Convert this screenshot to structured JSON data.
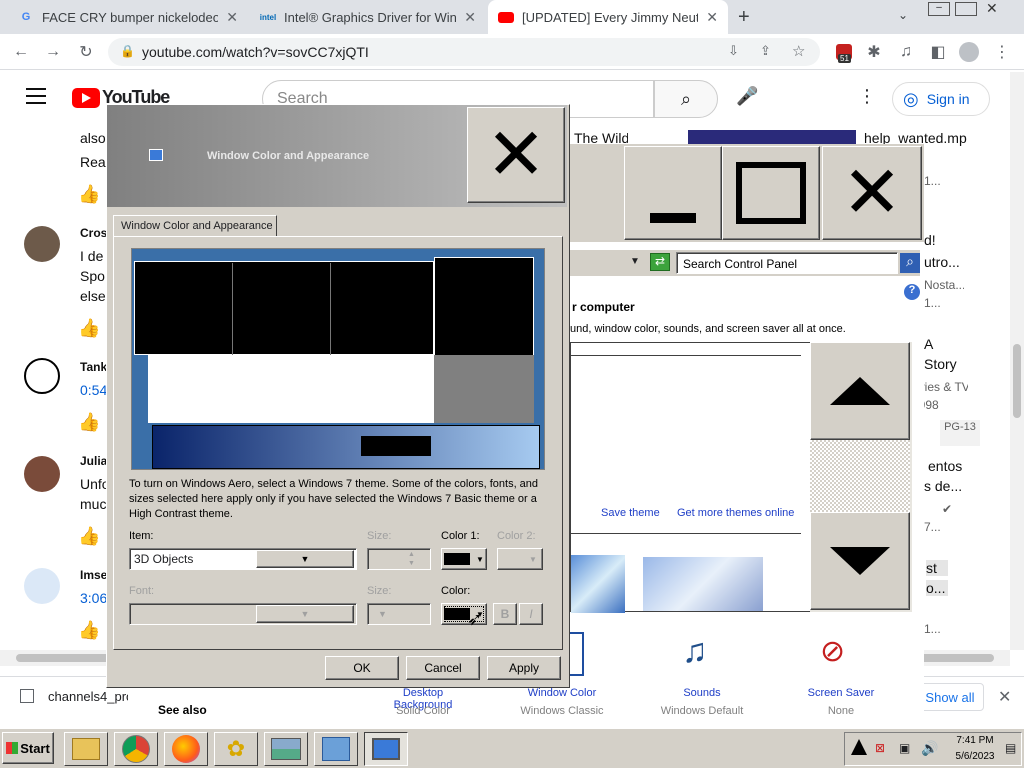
{
  "browser": {
    "tabs": [
      {
        "title": "FACE CRY bumper nickelodeon -",
        "icon": "google-favicon"
      },
      {
        "title": "Intel® Graphics Driver for Windo",
        "icon": "intel-favicon"
      },
      {
        "title": "[UPDATED] Every Jimmy Neutron",
        "icon": "youtube-favicon"
      }
    ],
    "url": "youtube.com/watch?v=sovCC7xjQTI",
    "extension_badge": "51"
  },
  "youtube": {
    "logo_text": "YouTube",
    "search_placeholder": "Search",
    "sign_in": "Sign in",
    "comments": [
      {
        "name": "",
        "line1": "also",
        "line2": "Rea"
      },
      {
        "name": "Cros",
        "line1": "I de",
        "line2": "Spo",
        "line3": "else"
      },
      {
        "name": "Tank",
        "line1": "0:54"
      },
      {
        "name": "Julia",
        "line1": "Unfo",
        "line2": "muc"
      },
      {
        "name": "Imse",
        "line1": "3:06"
      }
    ],
    "related": [
      {
        "title": "help_wanted.mp",
        "meta": "1..."
      },
      {
        "title": "d!",
        "title2": "utro...",
        "meta": "Nosta...",
        "meta2": "1..."
      },
      {
        "title": "A",
        "title2": "Story",
        "meta": "ovies & TV",
        "meta2": "1998",
        "badge": "PG-13"
      },
      {
        "title": "entos",
        "title2": "s de...",
        "meta": "7..."
      },
      {
        "title": "st",
        "title2": "o...",
        "meta": "1..."
      }
    ],
    "top_snippet": "The Wild",
    "download_item": "channels4_pro",
    "show_all": "Show all"
  },
  "control_panel": {
    "search_placeholder": "Search Control Panel",
    "heading": "r computer",
    "desc": "und, window color, sounds, and screen saver all at once.",
    "save_theme": "Save theme",
    "more_themes": "Get more themes online",
    "items": [
      {
        "label": "Desktop Background",
        "sub": "Solid Color"
      },
      {
        "label": "Window Color",
        "sub": "Windows Classic"
      },
      {
        "label": "Sounds",
        "sub": "Windows Default"
      },
      {
        "label": "Screen Saver",
        "sub": "None"
      }
    ],
    "see_also": "See also"
  },
  "dialog": {
    "title": "Window Color and Appearance",
    "tab": "Window Color and Appearance",
    "info": "To turn on Windows Aero, select a Windows 7 theme.  Some of the colors, fonts, and sizes selected here apply only if you have selected the Windows 7 Basic theme or a High Contrast theme.",
    "item_label": "Item:",
    "item_value": "3D Objects",
    "size_label": "Size:",
    "color1_label": "Color 1:",
    "color2_label": "Color 2:",
    "font_label": "Font:",
    "size2_label": "Size:",
    "color_label": "Color:",
    "bold": "B",
    "italic": "I",
    "ok": "OK",
    "cancel": "Cancel",
    "apply": "Apply"
  },
  "taskbar": {
    "start": "Start",
    "time": "7:41 PM",
    "date": "5/6/2023"
  },
  "colors": {
    "youtube_red": "#ff0000",
    "link_blue": "#065fd4",
    "win_face": "#d4d0c8"
  }
}
